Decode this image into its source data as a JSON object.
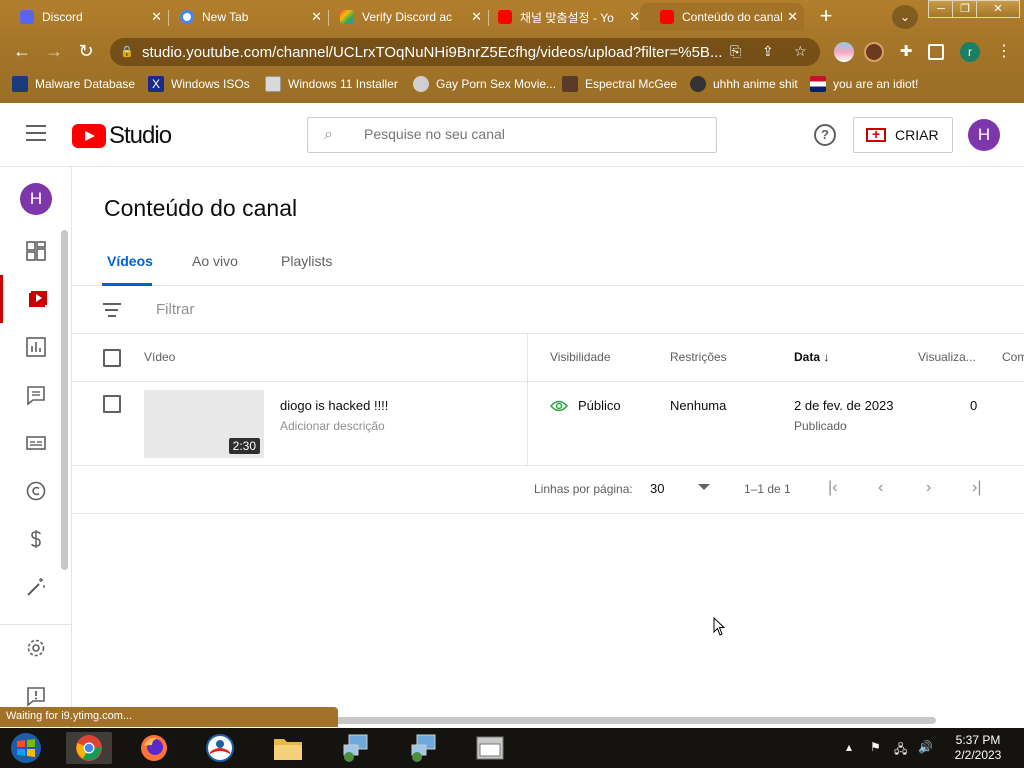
{
  "browser": {
    "tabs": [
      {
        "title": "Discord",
        "active": false
      },
      {
        "title": "New Tab",
        "active": false
      },
      {
        "title": "Verify Discord ac",
        "active": false
      },
      {
        "title": "채널 맞춤설정 - Yo",
        "active": false
      },
      {
        "title": "Conteúdo do canal",
        "active": true
      }
    ],
    "url": "studio.youtube.com/channel/UCLrxTOqNuNHi9BnrZ5Ecfhg/videos/upload?filter=%5B...",
    "bookmarks": [
      "Malware Database",
      "Windows ISOs",
      "Windows 11 Installer",
      "Gay Porn Sex Movie...",
      "Espectral McGee",
      "uhhh anime shit",
      "you are an idiot!"
    ],
    "profile_initial": "r",
    "status_text": "Waiting for i9.ytimg.com..."
  },
  "header": {
    "logo_text": "Studio",
    "search_placeholder": "Pesquise no seu canal",
    "create_label": "CRIAR",
    "avatar_initial": "H"
  },
  "sidebar": {
    "avatar_initial": "H",
    "items": [
      "dashboard",
      "content",
      "analytics",
      "comments",
      "subtitles",
      "copyright",
      "earn",
      "customization",
      "settings",
      "feedback"
    ]
  },
  "main": {
    "page_title": "Conteúdo do canal",
    "tabs": [
      "Vídeos",
      "Ao vivo",
      "Playlists"
    ],
    "filter_placeholder": "Filtrar",
    "columns": {
      "video": "Vídeo",
      "visibility": "Visibilidade",
      "restrictions": "Restrições",
      "date": "Data",
      "views": "Visualiza...",
      "comments": "Com"
    },
    "rows": [
      {
        "title": "diogo is hacked !!!!",
        "description": "Adicionar descrição",
        "duration": "2:30",
        "visibility": "Público",
        "restrictions": "Nenhuma",
        "date": "2 de fev. de 2023",
        "date_status": "Publicado",
        "views": "0"
      }
    ],
    "pagination": {
      "rows_per_page_label": "Linhas por página:",
      "rows_per_page": "30",
      "range": "1–1 de 1"
    }
  },
  "taskbar": {
    "time": "5:37 PM",
    "date": "2/2/2023"
  },
  "colors": {
    "accent_blue": "#065fd4",
    "youtube_red": "#ff0000",
    "avatar_purple": "#7e36ab",
    "chrome_frame": "#a27226"
  }
}
